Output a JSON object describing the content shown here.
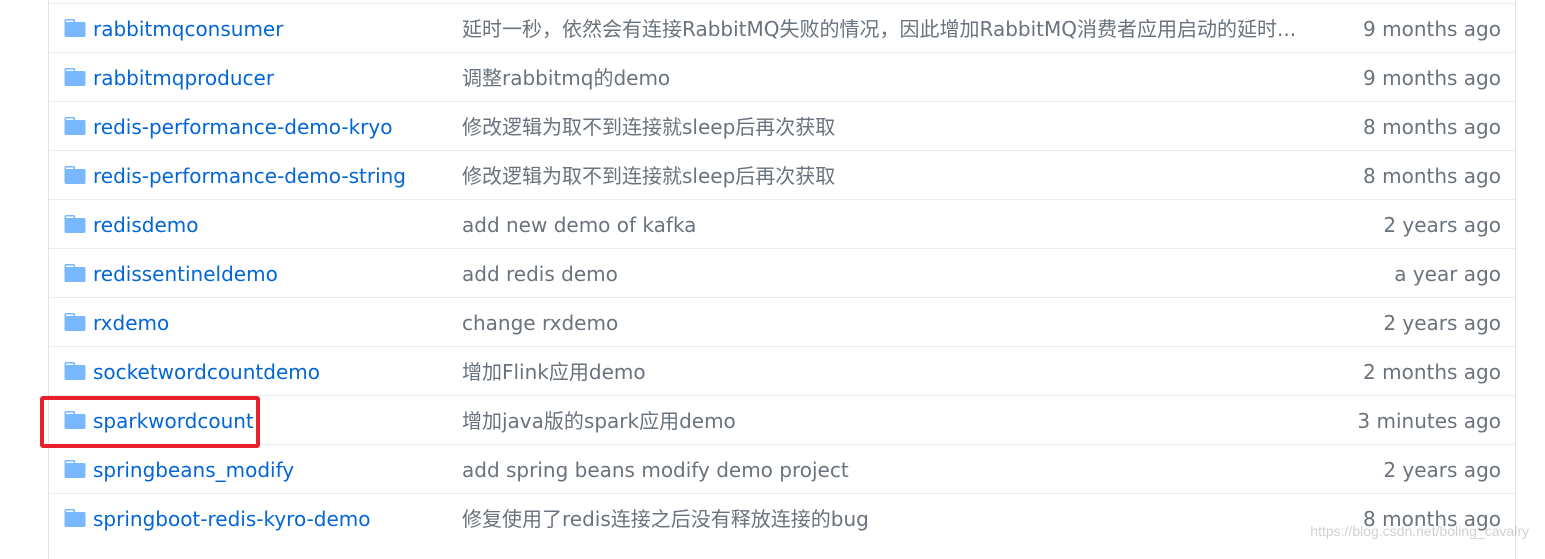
{
  "colors": {
    "link": "#0366d6",
    "muted": "#6a737d",
    "folder_icon": "#79b8ff",
    "highlight": "#e8202a"
  },
  "file_list": {
    "rows": [
      {
        "name": "rabbitmqconsumer",
        "icon": "folder-icon",
        "message": "延时一秒，依然会有连接RabbitMQ失败的情况，因此增加RabbitMQ消费者应用启动的延时...",
        "age": "9 months ago"
      },
      {
        "name": "rabbitmqproducer",
        "icon": "folder-icon",
        "message": "调整rabbitmq的demo",
        "age": "9 months ago"
      },
      {
        "name": "redis-performance-demo-kryo",
        "icon": "folder-icon",
        "message": "修改逻辑为取不到连接就sleep后再次获取",
        "age": "8 months ago"
      },
      {
        "name": "redis-performance-demo-string",
        "icon": "folder-icon",
        "message": "修改逻辑为取不到连接就sleep后再次获取",
        "age": "8 months ago"
      },
      {
        "name": "redisdemo",
        "icon": "folder-icon",
        "message": "add new demo of kafka",
        "age": "2 years ago"
      },
      {
        "name": "redissentineldemo",
        "icon": "folder-icon",
        "message": "add redis demo",
        "age": "a year ago"
      },
      {
        "name": "rxdemo",
        "icon": "folder-icon",
        "message": "change rxdemo",
        "age": "2 years ago"
      },
      {
        "name": "socketwordcountdemo",
        "icon": "folder-icon",
        "message": "增加Flink应用demo",
        "age": "2 months ago"
      },
      {
        "name": "sparkwordcount",
        "icon": "folder-icon",
        "message": "增加java版的spark应用demo",
        "age": "3 minutes ago",
        "highlighted": true
      },
      {
        "name": "springbeans_modify",
        "icon": "folder-icon",
        "message": "add spring beans modify demo project",
        "age": "2 years ago"
      },
      {
        "name": "springboot-redis-kyro-demo",
        "icon": "folder-icon",
        "message": "修复使用了redis连接之后没有释放连接的bug",
        "age": "8 months ago"
      }
    ]
  },
  "watermark": "https://blog.csdn.net/boling_cavalry"
}
